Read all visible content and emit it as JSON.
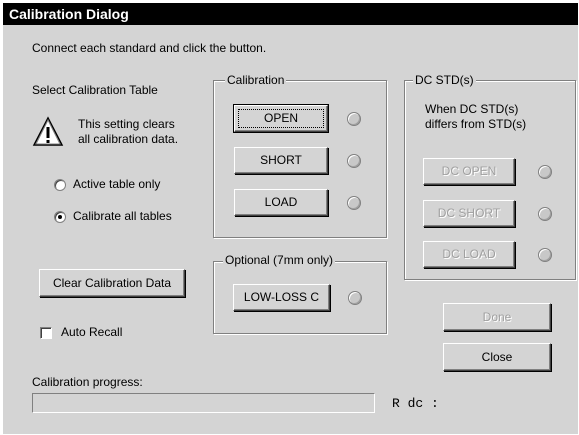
{
  "window": {
    "title": "Calibration Dialog"
  },
  "instruction": "Connect each standard and click the button.",
  "table_select": {
    "label": "Select Calibration Table",
    "warning_line1": "This setting clears",
    "warning_line2": "all calibration data.",
    "options": [
      {
        "label": "Active table only",
        "selected": false
      },
      {
        "label": "Calibrate all tables",
        "selected": true
      }
    ]
  },
  "calibration": {
    "label": "Calibration",
    "buttons": [
      {
        "label": "OPEN"
      },
      {
        "label": "SHORT"
      },
      {
        "label": "LOAD"
      }
    ]
  },
  "optional": {
    "label": "Optional (7mm only)",
    "button": "LOW-LOSS C"
  },
  "dc_std": {
    "label": "DC STD(s)",
    "note_line1": "When DC STD(s)",
    "note_line2": "differs from STD(s)",
    "buttons": [
      {
        "label": "DC OPEN"
      },
      {
        "label": "DC SHORT"
      },
      {
        "label": "DC LOAD"
      }
    ]
  },
  "actions": {
    "clear": "Clear Calibration Data",
    "auto_recall": "Auto Recall",
    "auto_recall_checked": false,
    "done": "Done",
    "close": "Close"
  },
  "progress": {
    "label": "Calibration progress:",
    "value": 0,
    "readout": "R dc :"
  }
}
